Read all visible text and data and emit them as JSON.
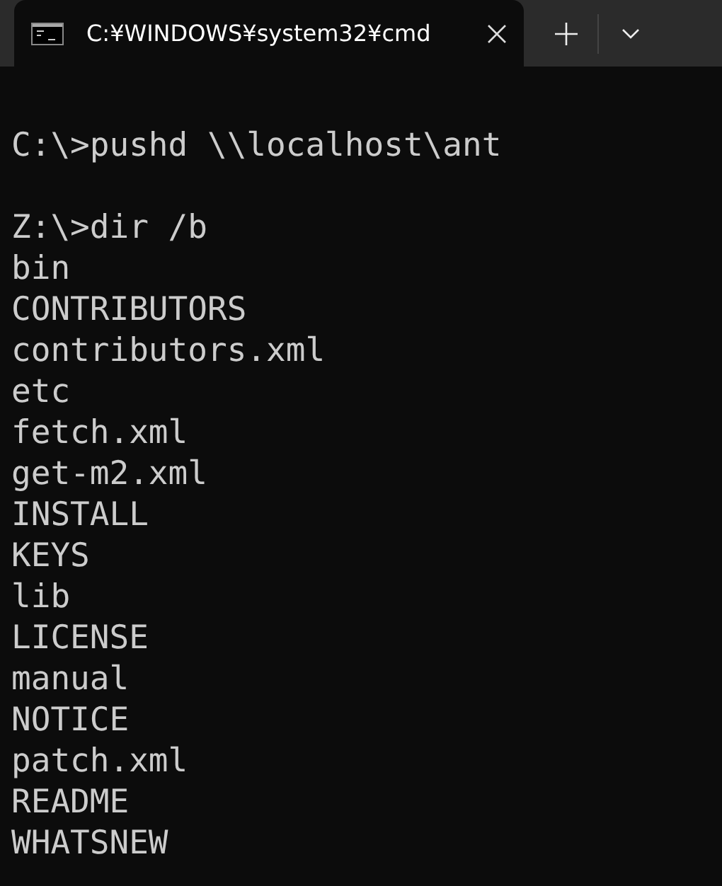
{
  "tabs": [
    {
      "title": "C:¥WINDOWS¥system32¥cmd",
      "selected": true
    }
  ],
  "terminal": {
    "blocks": [
      {
        "lines": [
          "C:\\>pushd \\\\localhost\\ant"
        ]
      },
      {
        "lines": [
          "Z:\\>dir /b",
          "bin",
          "CONTRIBUTORS",
          "contributors.xml",
          "etc",
          "fetch.xml",
          "get-m2.xml",
          "INSTALL",
          "KEYS",
          "lib",
          "LICENSE",
          "manual",
          "NOTICE",
          "patch.xml",
          "README",
          "WHATSNEW"
        ]
      }
    ]
  }
}
